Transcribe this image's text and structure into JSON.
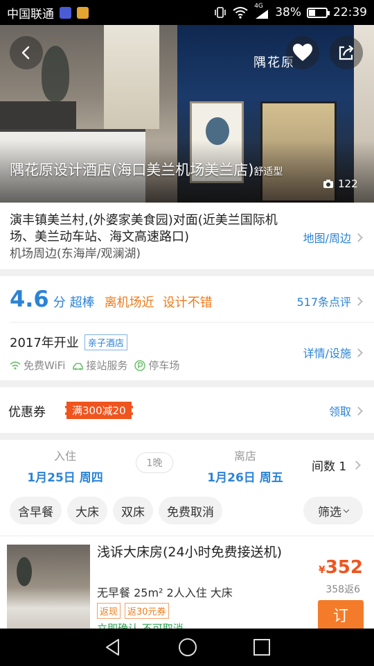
{
  "status_bar": {
    "carrier": "中国联通",
    "network": "4G",
    "battery_percent": "38%",
    "battery_level": 0.38,
    "time": "22:39"
  },
  "hero": {
    "storefront_sign": "隅花原",
    "hotel_name": "隅花原设计酒店(海口美兰机场美兰店)",
    "hotel_type": "舒适型",
    "photo_count": "122",
    "icons": [
      "back-arrow-icon",
      "heart-icon",
      "share-icon",
      "camera-icon"
    ]
  },
  "address": {
    "line": "演丰镇美兰村,(外婆家美食园)对面(近美兰国际机场、美兰动车站、海文高速路口)",
    "area": "机场周边(东海岸/观澜湖)",
    "map_link": "地图/周边"
  },
  "rating": {
    "score": "4.6",
    "unit": "分",
    "word": "超棒",
    "tags": [
      "离机场近",
      "设计不错"
    ],
    "reviews": "517条点评",
    "opened": "2017年开业",
    "kid_badge": "亲子酒店",
    "facilities": [
      "免费WiFi",
      "接站服务",
      "停车场"
    ],
    "details_link": "详情/设施"
  },
  "coupon": {
    "label": "优惠券",
    "badge": "满300减20",
    "claim": "领取"
  },
  "dates": {
    "checkin_label": "入住",
    "checkin_date": "1月25日 周四",
    "nights": "1晚",
    "checkout_label": "离店",
    "checkout_date": "1月26日 周五",
    "rooms_label": "间数 1",
    "chips": [
      "含早餐",
      "大床",
      "双床",
      "免费取消"
    ],
    "filter": "筛选"
  },
  "room": {
    "title": "浅诉大床房(24小时免费接送机)",
    "spec": "无早餐 25m² 2人入住 大床",
    "tags": [
      "返现",
      "返30元券"
    ],
    "cut_text": "立即确认   不可取消",
    "currency": "¥",
    "price": "352",
    "original": "358返6",
    "book": "订"
  },
  "colors": {
    "accent_blue": "#2b83d6",
    "accent_orange": "#f07a1a",
    "coupon_red": "#f0541e",
    "book_orange": "#f47b29"
  }
}
